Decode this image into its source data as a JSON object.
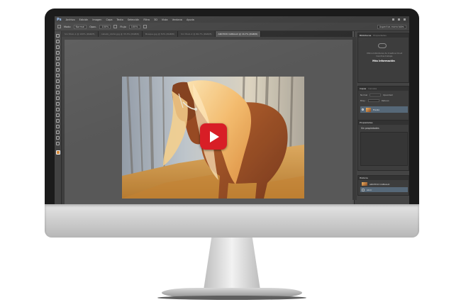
{
  "app": {
    "logo": "Ps",
    "menu": [
      "Archivo",
      "Edición",
      "Imagen",
      "Capa",
      "Texto",
      "Selección",
      "Filtro",
      "3D",
      "Vista",
      "Ventana",
      "Ayuda"
    ]
  },
  "options_bar": {
    "mode_label": "Modo",
    "mode_value": "Normal",
    "opacity_label": "Opac.",
    "opacity_value": "100%",
    "flow_label": "Flujo",
    "flow_value": "100%",
    "workspace": "Aspectos esenciales"
  },
  "document_tabs": [
    {
      "label": "Sin título-1 @ 100% (RGB/8)",
      "active": false
    },
    {
      "label": "caballo_otoño.jpg @ 33,3% (RGB/8)",
      "active": false
    },
    {
      "label": "Bosque.jpg @ 50% (RGB/8)",
      "active": false
    },
    {
      "label": "Sin título-2 @ 66,7% (RGB/8)",
      "active": false
    },
    {
      "label": "ARCHIVO CABALLO @ 16,7% (RGB/8)",
      "active": true
    }
  ],
  "panels": {
    "libraries": {
      "tabs": [
        "Bibliotecas",
        "Propiedades"
      ],
      "message": "Utilice bibliotecas de Creative Cloud mientras trabaja.",
      "link": "Más información"
    },
    "layers": {
      "tabs": [
        "Capas",
        "Canales"
      ],
      "blend_label": "Normal",
      "opacity_label": "Opacidad:",
      "fill_label": "Relleno:",
      "lock_label": "Bloq.:",
      "layer_name": "Fondo"
    },
    "properties": {
      "title": "Propiedades",
      "body": "Sin propiedades"
    },
    "history": {
      "title": "Historia",
      "items": [
        {
          "label": "ARCHIVO CABALLO",
          "active": false
        },
        {
          "label": "Abrir",
          "active": true
        }
      ]
    }
  },
  "video": {
    "play_button": "play-icon"
  },
  "colors": {
    "play_red": "#d81e26",
    "ui_dark": "#535353",
    "selection": "#566878"
  }
}
